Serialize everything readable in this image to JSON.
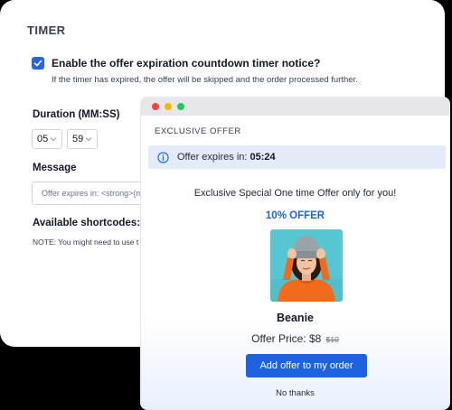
{
  "settings": {
    "section_title": "TIMER",
    "enable_checkbox_checked": true,
    "enable_label": "Enable the offer expiration countdown timer notice?",
    "help_text": "If the timer has expired, the offer will be skipped and the order processed further.",
    "duration_label": "Duration (MM:SS)",
    "duration_minutes": "05",
    "duration_seconds": "59",
    "message_label": "Message",
    "message_value": "Offer expires in: <strong>{m",
    "shortcodes_label": "Available shortcodes: {mi",
    "note": "NOTE: You might need to use t"
  },
  "popup": {
    "header": "EXCLUSIVE OFFER",
    "expiry_label": "Offer expires in:",
    "expiry_time": "05:24",
    "headline": "Exclusive Special One time Offer only for you!",
    "offer_badge": "10% OFFER",
    "product_name": "Beanie",
    "price_label": "Offer Price: $8",
    "old_price": "$10",
    "add_button": "Add offer to my order",
    "no_thanks": "No thanks"
  },
  "colors": {
    "accent": "#1d63e0",
    "checkbox": "#2563eb",
    "expiry_bar": "#e3ebf8"
  },
  "icons": {
    "checkbox": "check-icon",
    "select": "chevron-down-icon",
    "expiry": "info-icon"
  }
}
